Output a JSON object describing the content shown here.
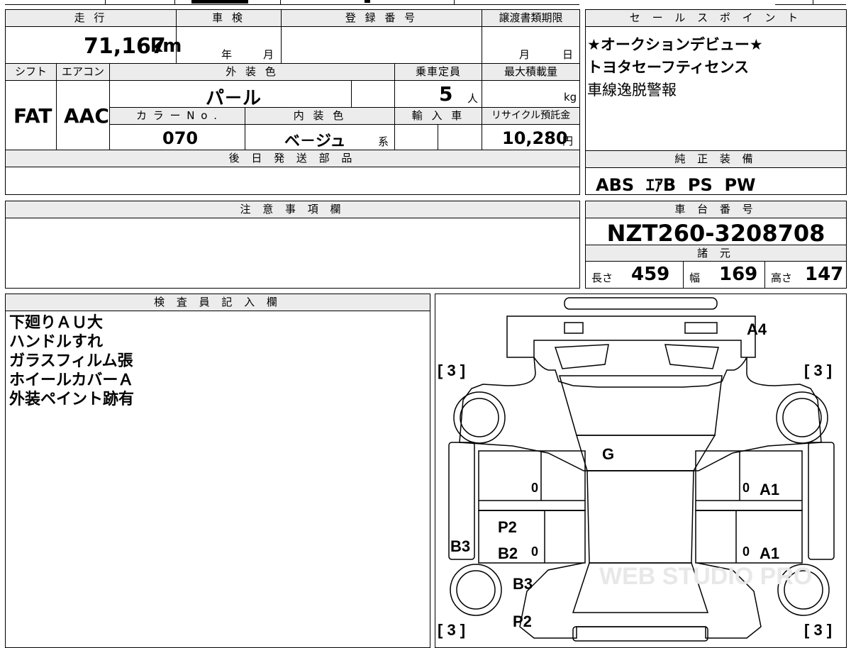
{
  "top_partial": [
    "",
    ""
  ],
  "main_sheet": {
    "headers": {
      "mileage": "走 行",
      "inspection": "車 検",
      "registration_no": "登 録 番 号",
      "transfer_deadline": "譲渡書類期限",
      "shift": "シフト",
      "aircon": "エアコン",
      "exterior_color": "外 装 色",
      "capacity": "乗車定員",
      "max_load": "最大積載量",
      "color_no": "カ ラ ー N o .",
      "interior_color": "内 装 色",
      "import": "輸 入 車",
      "recycle_fee": "リサイクル預託金",
      "later_parts": "後 日 発 送 部 品"
    },
    "mileage_value": "71,167",
    "mileage_unit": "km",
    "inspection_year": "年",
    "inspection_month": "月",
    "transfer_month": "月",
    "transfer_day": "日",
    "shift_value": "FAT",
    "aircon_value": "AAC",
    "exterior_color_value": "パ－ル",
    "capacity_value": "5",
    "capacity_unit": "人",
    "load_unit": "kg",
    "color_no_value": "070",
    "interior_color_value": "ベ－ジュ",
    "interior_suffix": "系",
    "recycle_value": "10,280",
    "recycle_unit": "円"
  },
  "sales_points": {
    "header": "セ ー ル ス ポ イ ン ト",
    "lines": [
      "★オークションデビュー★",
      "トヨタセーフティセンス",
      "車線逸脱警報"
    ]
  },
  "equipment": {
    "header": "純 正 装 備",
    "items": "ABS  ｴｱB  PS  PW"
  },
  "notes": {
    "header": "注 意 事 項 欄"
  },
  "chassis": {
    "header": "車 台 番 号",
    "number": "NZT260-3208708"
  },
  "specs": {
    "header": "諸 元",
    "length_label": "長さ",
    "length_value": "459",
    "width_label": "幅",
    "width_value": "169",
    "height_label": "高さ",
    "height_value": "147"
  },
  "inspector": {
    "header": "検 査 員 記 入 欄",
    "lines": [
      "下廻りＡＵ大",
      "ハンドルすれ",
      "ガラスフィルム張",
      "ホイールカバーＡ",
      "外装ペイント跡有"
    ]
  },
  "diagram": {
    "tire_marks": [
      "[ 3 ]",
      "[ 3 ]",
      "[ 3 ]",
      "[ 3 ]"
    ],
    "labels": {
      "a4": "A4",
      "g": "G",
      "a1_front": "A1",
      "a1_rear": "A1",
      "p2_upper": "P2",
      "b2": "B2",
      "b3_side": "B3",
      "b3_rear": "B3",
      "p2_lower": "P2",
      "zero_1": "0",
      "zero_2": "0",
      "zero_3": "0",
      "zero_4": "0"
    },
    "watermark": "WEB STUDIO PRO"
  }
}
